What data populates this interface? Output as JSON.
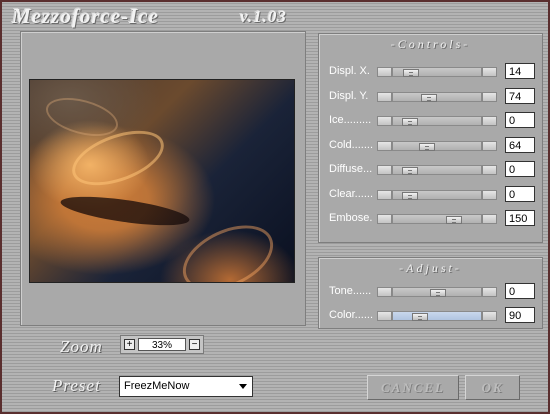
{
  "window": {
    "title_left": "Mezzoforce-Ice",
    "title_right": "v.1.03"
  },
  "controls": {
    "title": "-Controls-",
    "rows": [
      {
        "label": "Displ. X.",
        "value": "14",
        "level": 0.14
      },
      {
        "label": "Displ. Y.",
        "value": "74",
        "level": 0.38
      },
      {
        "label": "Ice.........",
        "value": "0",
        "level": 0.12
      },
      {
        "label": "Cold.......",
        "value": "64",
        "level": 0.35
      },
      {
        "label": "Diffuse...",
        "value": "0",
        "level": 0.12
      },
      {
        "label": "Clear......",
        "value": "0",
        "level": 0.12
      },
      {
        "label": "Embose.",
        "value": "150",
        "level": 0.72
      }
    ]
  },
  "adjust": {
    "title": "-Adjust-",
    "rows": [
      {
        "label": "Tone......",
        "value": "0",
        "level": 0.5
      },
      {
        "label": "Color......",
        "value": "90",
        "level": 0.25
      }
    ]
  },
  "zoom": {
    "label": "Zoom",
    "value": "33%",
    "plus": "+",
    "minus": "−"
  },
  "preset": {
    "label": "Preset",
    "value": "FreezMeNow"
  },
  "buttons": {
    "cancel": "CANCEL",
    "ok": "OK"
  }
}
